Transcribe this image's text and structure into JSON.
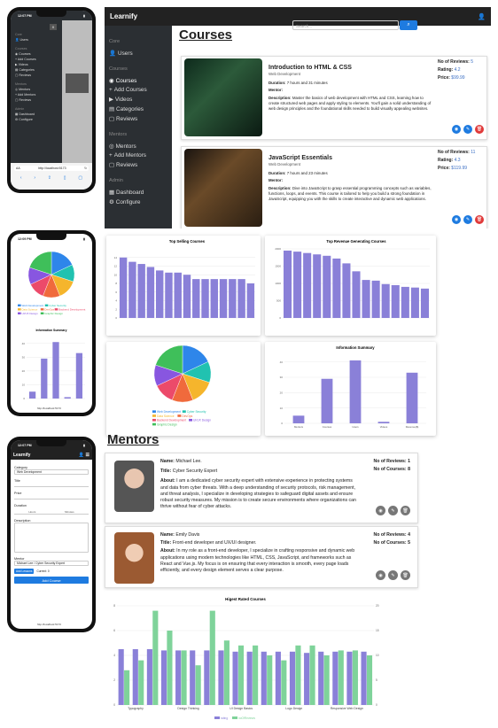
{
  "app": {
    "brand": "Learnify"
  },
  "desktop": {
    "sidebar": {
      "core": "Core",
      "users": "Users",
      "courses_sec": "Courses",
      "courses": "Courses",
      "add_courses": "Add Courses",
      "videos": "Videos",
      "categories": "Categories",
      "reviews": "Reviews",
      "mentors_sec": "Mentors",
      "mentors": "Mentors",
      "add_mentors": "Add Mentors",
      "mreviews": "Reviews",
      "admin_sec": "Admin",
      "dashboard": "Dashboard",
      "configure": "Configure"
    },
    "page_title": "Courses",
    "search": {
      "placeholder": "Search..."
    },
    "courses": [
      {
        "title": "Introduction to HTML & CSS",
        "category": "Web Development",
        "duration_label": "Duration:",
        "duration": "7 hours and 31 minutes",
        "mentor_label": "Mentor:",
        "desc_label": "Description:",
        "desc": "Master the basics of web development with HTML and CSS, learning how to create structured web pages and apply styling to elements. You'll gain a solid understanding of web design principles and the foundational skills needed to build visually appealing websites.",
        "reviews_label": "No of Reviews:",
        "reviews": "5",
        "rating_label": "Rating:",
        "rating": "4.2",
        "price_label": "Price:",
        "price": "$99.99"
      },
      {
        "title": "JavaScript Essentials",
        "category": "Web Development",
        "duration_label": "Duration:",
        "duration": "7 hours and 23 minutes",
        "mentor_label": "Mentor:",
        "desc_label": "Description:",
        "desc": "Dive into JavaScript to grasp essential programming concepts such as variables, functions, loops, and events. This course is tailored to help you build a strong foundation in JavaScript, equipping you with the skills to create interactive and dynamic web applications.",
        "reviews_label": "No of Reviews:",
        "reviews": "11",
        "rating_label": "Rating:",
        "rating": "4.3",
        "price_label": "Price:",
        "price": "$119.99"
      }
    ]
  },
  "phone1": {
    "time": "12:07 PM",
    "url": "http://localhost:5173",
    "aa": "AA",
    "items": {
      "core": "Core",
      "users": "Users",
      "courses_sec": "Courses",
      "courses": "Courses",
      "add_courses": "Add Courses",
      "videos": "Videos",
      "categories": "Categories",
      "reviews": "Reviews",
      "mentors_sec": "Mentors",
      "mentors": "Mentors",
      "add_mentors": "Add Mentors",
      "mreviews": "Reviews",
      "admin_sec": "Admin",
      "dashboard": "Dashboard",
      "configure": "Configure"
    }
  },
  "phone2": {
    "time": "12:09 PM",
    "url": "http://localhost:5173",
    "summary_title": "Information Summary"
  },
  "phone3": {
    "time": "12:07 PM",
    "url": "http://localhost:5173",
    "brand": "Learnify",
    "category_label": "Category",
    "category": "Web Development",
    "title_label": "Title",
    "price_label": "Price",
    "duration_label": "Duration",
    "hours": "Hours",
    "minutes": "Minutes",
    "desc_label": "Description",
    "mentor_label": "Mentor",
    "mentor": "Michael Lee / Cyber Security Expert",
    "add_lessons": "Add Lessons",
    "current": "Current: 0",
    "add_course": "Add Course"
  },
  "charts": {
    "top_selling": {
      "title": "Top Selling Courses",
      "values": [
        14,
        13,
        12.5,
        11.8,
        11,
        10.5,
        10.5,
        10,
        9,
        9,
        9,
        9,
        9,
        9,
        8
      ],
      "ylim": [
        0,
        16
      ],
      "ticks": [
        "0",
        "2",
        "4",
        "6",
        "8",
        "10",
        "12",
        "14"
      ],
      "color": "#8a80d8"
    },
    "top_revenue": {
      "title": "Top Revenue Generating Courses",
      "values": [
        1950,
        1920,
        1880,
        1840,
        1800,
        1720,
        1580,
        1350,
        1100,
        1080,
        980,
        950,
        900,
        880,
        850
      ],
      "ylim": [
        0,
        2000
      ],
      "ticks": [
        "0",
        "500",
        "1000",
        "1500",
        "2000"
      ],
      "color": "#8a80d8"
    },
    "pie": {
      "legend": [
        "Web Development",
        "Cyber Security",
        "Data Science",
        "DevOps",
        "Backend Development",
        "UI/UX Design",
        "Graphic Design"
      ],
      "values": [
        18,
        12,
        14,
        12,
        12,
        12,
        20
      ],
      "colors": [
        "#2e86ea",
        "#21c2b0",
        "#f5b52c",
        "#f06a3c",
        "#ec4a6a",
        "#8856e0",
        "#3fbf5a"
      ]
    },
    "summary": {
      "title": "Information Summary",
      "categories": [
        "Mentors",
        "Courses",
        "Users",
        "Videos",
        "Revenue($)"
      ],
      "values": [
        5,
        29,
        41,
        1,
        33
      ],
      "ylim": [
        0,
        45
      ],
      "ticks": [
        "0",
        "10",
        "20",
        "30",
        "40"
      ],
      "color": "#8a80d8"
    },
    "highest_rated": {
      "title": "Higest Rated Courses",
      "categories": [
        "Typography",
        "Design Thinking",
        "UI Design Basics",
        "Logo Design",
        "Responsive Web Design"
      ],
      "rating": [
        4.5,
        4.5,
        4.5,
        4.4,
        4.4,
        4.4,
        4.4,
        4.4,
        4.3,
        4.3,
        4.3,
        4.3,
        4.3,
        4.2,
        4.3,
        4.3,
        4.3,
        4.3
      ],
      "reviews": [
        7,
        9,
        19,
        15,
        11,
        8,
        19,
        13,
        12,
        12,
        10,
        9,
        12,
        12,
        10,
        11,
        11,
        10
      ],
      "ylim_left": [
        0,
        8
      ],
      "ylim_right": [
        0,
        20
      ],
      "ticks_left": [
        "0",
        "2",
        "4",
        "6",
        "8"
      ],
      "ticks_right": [
        "0",
        "5",
        "10",
        "15",
        "20"
      ],
      "legend_rating": "rating",
      "legend_reviews": "noOfReviews",
      "color_rating": "#8a80d8",
      "color_reviews": "#7fd39a"
    }
  },
  "mentors": {
    "title": "Mentors",
    "list": [
      {
        "name_label": "Name:",
        "name": "Michael Lee.",
        "title_label": "Title:",
        "title": "Cyber Security Expert",
        "about_label": "About:",
        "about": "I am a dedicated cyber security expert with extensive experience in protecting systems and data from cyber threats. With a deep understanding of security protocols, risk management, and threat analysis, I specialize in developing strategies to safeguard digital assets and ensure robust security measures. My mission is to create secure environments where organizations can thrive without fear of cyber attacks.",
        "reviews_label": "No of Reviews:",
        "reviews": "1",
        "courses_label": "No of Courses:",
        "courses": "8"
      },
      {
        "name_label": "Name:",
        "name": "Emily Davis",
        "title_label": "Title:",
        "title": "Front-end developer and UX/UI designer.",
        "about_label": "About:",
        "about": "In my role as a front-end developer, I specialize in crafting responsive and dynamic web applications using modern technologies like HTML, CSS, JavaScript, and frameworks such as React and Vue.js. My focus is on ensuring that every interaction is smooth, every page loads efficiently, and every design element serves a clear purpose.",
        "reviews_label": "No of Reviews:",
        "reviews": "4",
        "courses_label": "No of Courses:",
        "courses": "5"
      }
    ]
  }
}
